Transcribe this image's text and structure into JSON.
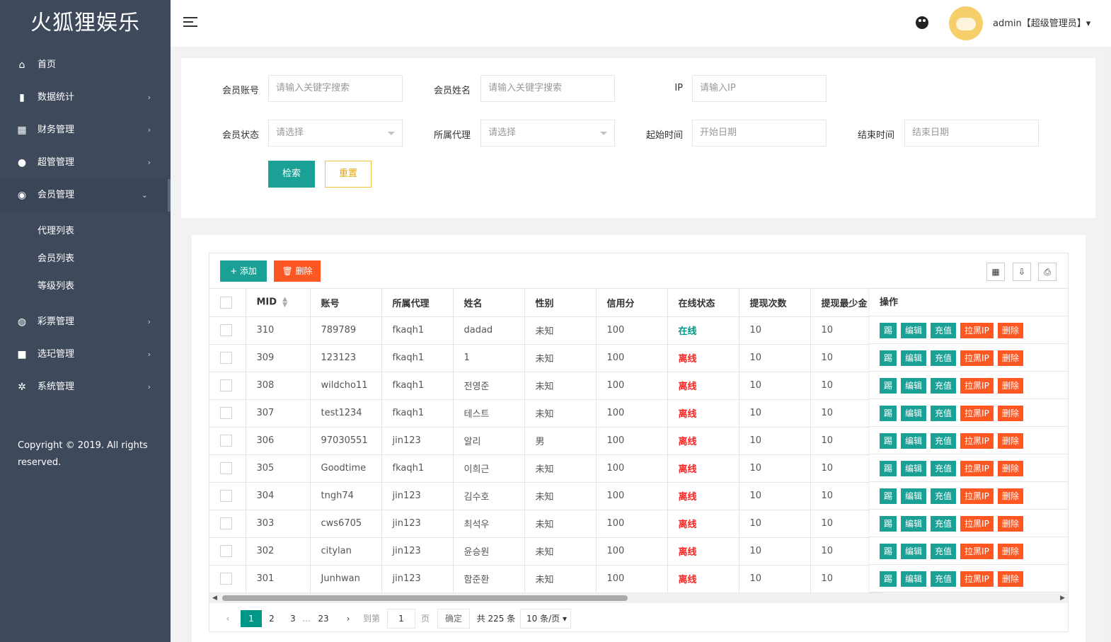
{
  "brand": "火狐狸娱乐",
  "sidebar": {
    "items": [
      {
        "label": "首页",
        "icon": "home-icon",
        "glyph": "⌂",
        "arrow": ""
      },
      {
        "label": "数据统计",
        "icon": "bar-chart-icon",
        "glyph": "▮",
        "arrow": "›"
      },
      {
        "label": "财务管理",
        "icon": "bank-icon",
        "glyph": "▦",
        "arrow": "›"
      },
      {
        "label": "超管管理",
        "icon": "user-icon",
        "glyph": "●",
        "arrow": "›"
      },
      {
        "label": "会员管理",
        "icon": "users-icon",
        "glyph": "◉",
        "arrow": "⌄"
      }
    ],
    "sub_items": [
      {
        "label": "代理列表"
      },
      {
        "label": "会员列表"
      },
      {
        "label": "等级列表"
      }
    ],
    "items2": [
      {
        "label": "彩票管理",
        "icon": "gamepad-icon",
        "glyph": "◍",
        "arrow": "›"
      },
      {
        "label": "选玘管理",
        "icon": "video-icon",
        "glyph": "■",
        "arrow": "›"
      },
      {
        "label": "系统管理",
        "icon": "gear-icon",
        "glyph": "✲",
        "arrow": "›"
      }
    ],
    "copyright": "Copyright © 2019. All rights reserved."
  },
  "header": {
    "user": "admin【超级管理员】▾"
  },
  "search": {
    "account_label": "会员账号",
    "account_placeholder": "请输入关键字搜索",
    "name_label": "会员姓名",
    "name_placeholder": "请输入关键字搜索",
    "ip_label": "IP",
    "ip_placeholder": "请输入IP",
    "status_label": "会员状态",
    "status_value": "请选择",
    "agent_label": "所属代理",
    "agent_value": "请选择",
    "start_label": "起始时间",
    "start_placeholder": "开始日期",
    "end_label": "结束时间",
    "end_placeholder": "结束日期",
    "search_btn": "检索",
    "reset_btn": "重置"
  },
  "toolbar": {
    "add": "+ 添加",
    "delete": "🗑 删除"
  },
  "table": {
    "headers": [
      "MID",
      "账号",
      "所属代理",
      "姓名",
      "性别",
      "信用分",
      "在线状态",
      "提现次数",
      "提现最少金"
    ],
    "ops_header": "操作",
    "ops": [
      "踢",
      "编辑",
      "充值",
      "拉黑IP",
      "删除"
    ],
    "rows": [
      {
        "mid": "310",
        "account": "789789",
        "agent": "fkaqh1",
        "name": "dadad",
        "gender": "未知",
        "credit": "100",
        "status": "在线",
        "online": true,
        "count": "10",
        "min": "10"
      },
      {
        "mid": "309",
        "account": "123123",
        "agent": "fkaqh1",
        "name": "1",
        "gender": "未知",
        "credit": "100",
        "status": "离线",
        "online": false,
        "count": "10",
        "min": "10"
      },
      {
        "mid": "308",
        "account": "wildcho11",
        "agent": "fkaqh1",
        "name": "전영준",
        "gender": "未知",
        "credit": "100",
        "status": "离线",
        "online": false,
        "count": "10",
        "min": "10"
      },
      {
        "mid": "307",
        "account": "test1234",
        "agent": "fkaqh1",
        "name": "테스트",
        "gender": "未知",
        "credit": "100",
        "status": "离线",
        "online": false,
        "count": "10",
        "min": "10"
      },
      {
        "mid": "306",
        "account": "97030551",
        "agent": "jin123",
        "name": "알리",
        "gender": "男",
        "credit": "100",
        "status": "离线",
        "online": false,
        "count": "10",
        "min": "10"
      },
      {
        "mid": "305",
        "account": "Goodtime",
        "agent": "fkaqh1",
        "name": "이희근",
        "gender": "未知",
        "credit": "100",
        "status": "离线",
        "online": false,
        "count": "10",
        "min": "10"
      },
      {
        "mid": "304",
        "account": "tngh74",
        "agent": "jin123",
        "name": "김수호",
        "gender": "未知",
        "credit": "100",
        "status": "离线",
        "online": false,
        "count": "10",
        "min": "10"
      },
      {
        "mid": "303",
        "account": "cws6705",
        "agent": "jin123",
        "name": "최석우",
        "gender": "未知",
        "credit": "100",
        "status": "离线",
        "online": false,
        "count": "10",
        "min": "10"
      },
      {
        "mid": "302",
        "account": "citylan",
        "agent": "jin123",
        "name": "윤승원",
        "gender": "未知",
        "credit": "100",
        "status": "离线",
        "online": false,
        "count": "10",
        "min": "10"
      },
      {
        "mid": "301",
        "account": "Junhwan",
        "agent": "jin123",
        "name": "함준환",
        "gender": "未知",
        "credit": "100",
        "status": "离线",
        "online": false,
        "count": "10",
        "min": "10"
      }
    ]
  },
  "pager": {
    "prev": "‹",
    "pages": [
      "1",
      "2",
      "3"
    ],
    "ellipsis": "…",
    "last": "23",
    "next": "›",
    "goto_label": "到第",
    "goto_value": "1",
    "page_unit": "页",
    "confirm": "确定",
    "total": "共 225 条",
    "per_page": "10 条/页 ▾"
  },
  "colors": {
    "sidebar": "#3e4a5c",
    "primary": "#1aa094",
    "danger": "#ff5722",
    "warn": "#f0c040",
    "online": "#009688",
    "offline": "#ff2222"
  }
}
